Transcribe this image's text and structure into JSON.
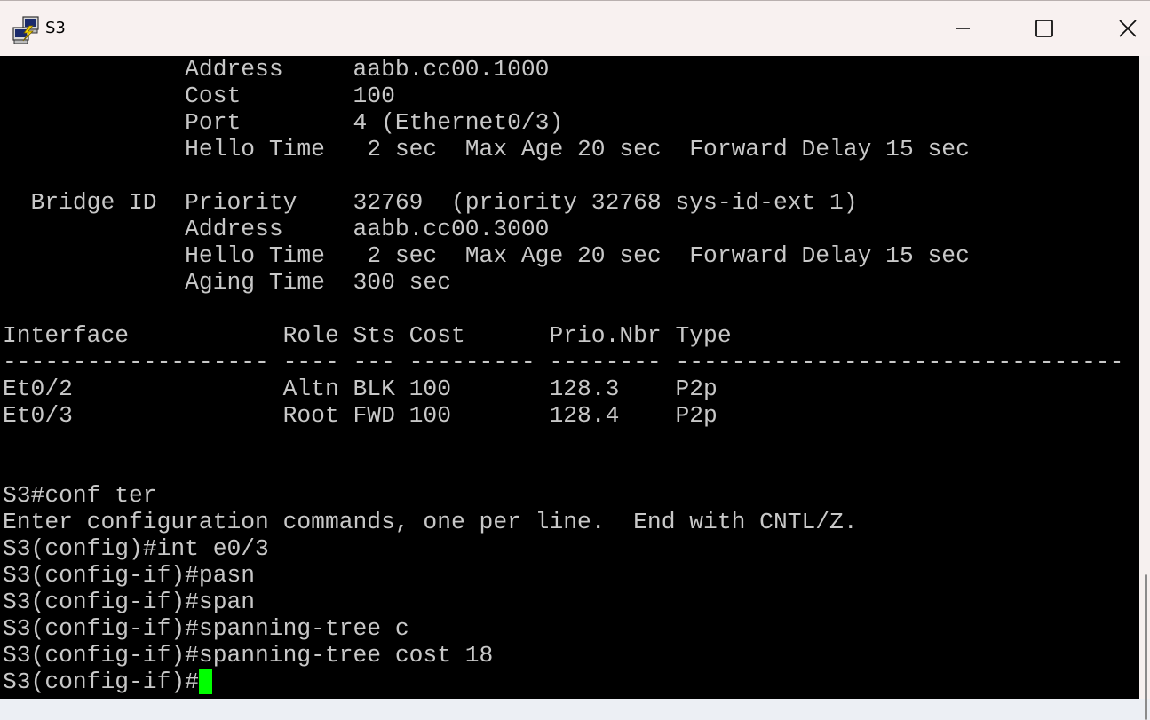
{
  "window": {
    "title": "S3",
    "icon": "putty-icon",
    "controls": [
      "minimize-icon",
      "maximize-icon",
      "close-icon"
    ]
  },
  "terminal": {
    "lines": [
      "             Address     aabb.cc00.1000",
      "             Cost        100",
      "             Port        4 (Ethernet0/3)",
      "             Hello Time   2 sec  Max Age 20 sec  Forward Delay 15 sec",
      "",
      "  Bridge ID  Priority    32769  (priority 32768 sys-id-ext 1)",
      "             Address     aabb.cc00.3000",
      "             Hello Time   2 sec  Max Age 20 sec  Forward Delay 15 sec",
      "             Aging Time  300 sec",
      "",
      "Interface           Role Sts Cost      Prio.Nbr Type",
      "------------------- ---- --- --------- -------- --------------------------------",
      "Et0/2               Altn BLK 100       128.3    P2p",
      "Et0/3               Root FWD 100       128.4    P2p",
      "",
      "",
      "S3#conf ter",
      "Enter configuration commands, one per line.  End with CNTL/Z.",
      "S3(config)#int e0/3",
      "S3(config-if)#pasn",
      "S3(config-if)#span",
      "S3(config-if)#spanning-tree c",
      "S3(config-if)#spanning-tree cost 18",
      "S3(config-if)#"
    ],
    "colors": {
      "background": "#000000",
      "foreground": "#c8c8c8",
      "cursor": "#00ff00"
    }
  }
}
